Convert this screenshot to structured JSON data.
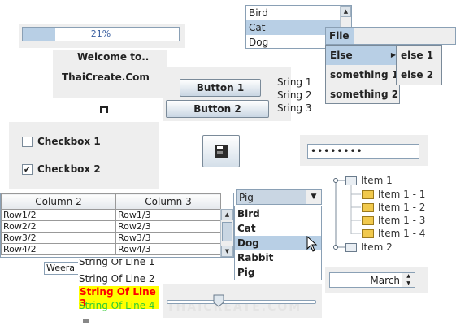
{
  "progress": {
    "label": "21%",
    "value": 0.21
  },
  "welcome": {
    "line1": "Welcome to..",
    "line2": "ThaiCreate.Com"
  },
  "buttons": {
    "button1": "Button 1",
    "button2": "Button 2"
  },
  "checkboxes": [
    {
      "label": "Checkbox 1",
      "checked": false,
      "mark": ""
    },
    {
      "label": "Checkbox 2",
      "checked": true,
      "mark": "✔"
    }
  ],
  "string_list": [
    "Sring 1",
    "Sring 2",
    "Sring 3"
  ],
  "animal_list": {
    "items": [
      "Bird",
      "Cat",
      "Dog"
    ],
    "selected": "Cat"
  },
  "menu": {
    "file": "File",
    "items": [
      "Else",
      "something 1",
      "something 2"
    ],
    "submenu_arrow": "▶",
    "submenu": [
      "else 1",
      "else 2"
    ]
  },
  "password": {
    "value": "••••••••"
  },
  "table": {
    "headers": [
      "Column 2",
      "Column 3"
    ],
    "rows": [
      [
        "Row1/2",
        "Row1/3"
      ],
      [
        "Row2/2",
        "Row2/3"
      ],
      [
        "Row3/2",
        "Row3/3"
      ],
      [
        "Row4/2",
        "Row4/3"
      ]
    ]
  },
  "combo": {
    "selected": "Pig",
    "options": [
      "Bird",
      "Cat",
      "Dog",
      "Rabbit",
      "Pig"
    ],
    "highlighted": "Dog",
    "arrow": "▼"
  },
  "tree": {
    "root1": "Item 1",
    "children": [
      "Item 1 - 1",
      "Item 1 - 2",
      "Item 1 - 3",
      "Item 1 - 4"
    ],
    "root2": "Item 2"
  },
  "text_field_partial": "Weera",
  "lines": [
    {
      "text": "String Of Line 1",
      "color": "#222222"
    },
    {
      "text": "String Of Line 2",
      "color": "#222222"
    },
    {
      "text": "String Of Line 3",
      "color": "#ff0000",
      "highlight": "#ffff00"
    },
    {
      "text": "String Of Line 4",
      "color": "#33cc33"
    }
  ],
  "spinner": {
    "value": "March",
    "up": "▲",
    "down": "▼"
  },
  "slider": {
    "value": 0.35
  },
  "scroll_arrows": {
    "up": "▲",
    "down": "▼"
  },
  "watermark": "THAICREATE.COM",
  "colors": {
    "selection": "#b8cfe5",
    "panel": "#eeeeee",
    "button_top": "#ffffff",
    "button_bottom": "#c9d6e3"
  }
}
